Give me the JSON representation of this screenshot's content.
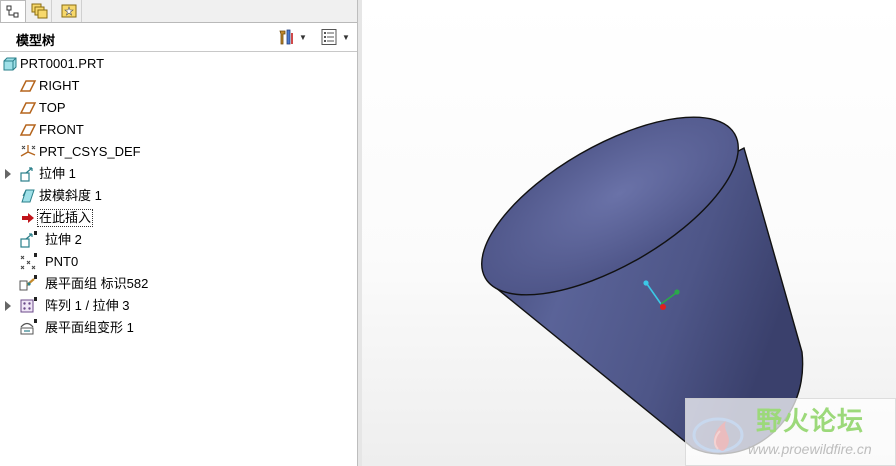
{
  "panel": {
    "title": "模型树",
    "tabs": [
      {
        "name": "model-tree-tab",
        "icon": "tree-structure-icon",
        "active": true
      },
      {
        "name": "folder-browser-tab",
        "icon": "folders-icon",
        "active": false
      },
      {
        "name": "favorites-tab",
        "icon": "star-folder-icon",
        "active": false
      }
    ],
    "tools": [
      {
        "name": "settings-button",
        "icon": "tools-icon"
      },
      {
        "name": "show-button",
        "icon": "list-icon"
      }
    ]
  },
  "tree": {
    "items": [
      {
        "label": "PRT0001.PRT",
        "icon": "part-icon",
        "expandable": false,
        "level": 0
      },
      {
        "label": "RIGHT",
        "icon": "datum-plane-icon",
        "expandable": false,
        "level": 1
      },
      {
        "label": "TOP",
        "icon": "datum-plane-icon",
        "expandable": false,
        "level": 1
      },
      {
        "label": "FRONT",
        "icon": "datum-plane-icon",
        "expandable": false,
        "level": 1
      },
      {
        "label": "PRT_CSYS_DEF",
        "icon": "coordinate-system-icon",
        "expandable": false,
        "level": 1
      },
      {
        "label": "拉伸 1",
        "icon": "extrude-icon",
        "expandable": true,
        "level": 1
      },
      {
        "label": "拔模斜度 1",
        "icon": "draft-icon",
        "expandable": false,
        "level": 1
      },
      {
        "label": "在此插入",
        "icon": "insert-here-arrow-icon",
        "expandable": false,
        "level": 1
      },
      {
        "label": "拉伸 2",
        "icon": "extrude-icon",
        "expandable": false,
        "level": 1
      },
      {
        "label": "PNT0",
        "icon": "datum-point-icon",
        "expandable": false,
        "level": 1
      },
      {
        "label": "展平面组 标识582",
        "icon": "flatten-quilt-icon",
        "expandable": false,
        "level": 1
      },
      {
        "label": "阵列 1 / 拉伸 3",
        "icon": "pattern-icon",
        "expandable": true,
        "level": 1
      },
      {
        "label": "展平面组变形 1",
        "icon": "flatten-deform-icon",
        "expandable": false,
        "level": 1
      }
    ]
  },
  "viewport": {
    "model_color": "#5a6398",
    "watermark": {
      "title": "野火论坛",
      "url": "www.proewildfire.cn"
    }
  }
}
